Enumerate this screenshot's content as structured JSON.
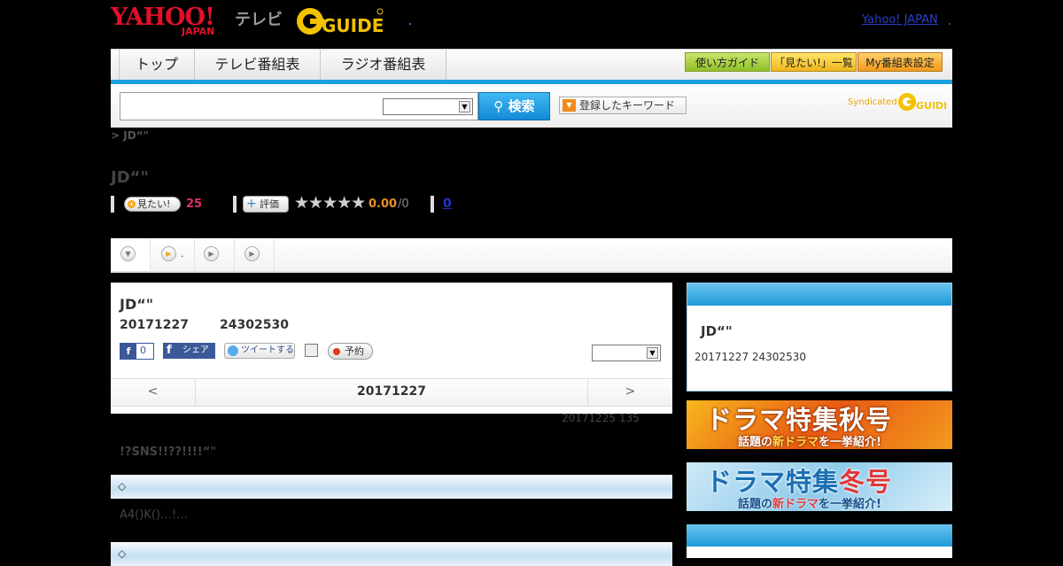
{
  "header": {
    "logo_yahoo": "YAHOO!",
    "logo_japan": "JAPAN",
    "logo_tv": "テレビ",
    "logo_gguide": "GUIDE",
    "yj_link": "Yahoo! JAPAN"
  },
  "nav": {
    "tabs": [
      {
        "label": "トップ"
      },
      {
        "label": "テレビ番組表"
      },
      {
        "label": "ラジオ番組表"
      }
    ],
    "buttons": [
      {
        "label": "使い方ガイド"
      },
      {
        "label": "「見たい!」一覧"
      },
      {
        "label": "My番組表設定"
      }
    ]
  },
  "search": {
    "placeholder": "",
    "button_label": "検索",
    "keyword_button": "登録したキーワード",
    "syndicated": "Syndicated"
  },
  "breadcrumb": "> JD“\"",
  "page_title": "JD“\"",
  "actions": {
    "mitai_label": "見たい!",
    "mitai_count": "25",
    "hyoka_label": "評価",
    "stars": "★★★★★",
    "rating": "0.00",
    "rating_total": "/0",
    "review_count": "0"
  },
  "tabs": [
    {
      "label": ""
    },
    {
      "label": "."
    },
    {
      "label": ""
    },
    {
      "label": ""
    }
  ],
  "program": {
    "title": "JD“\"",
    "date": "20171227",
    "time": "24302530",
    "fb_count": "0",
    "fb_share": "シェア",
    "tweet": "ツイートする",
    "reserve": "予約",
    "pager_prev": "<",
    "pager_date": "20171227",
    "pager_next": ">"
  },
  "meta": "20171225  135",
  "description": "!?SNS!!??!!!!“\"",
  "sections": [
    {
      "label": "◇",
      "body": "A4()K()…!…"
    },
    {
      "label": "◇"
    }
  ],
  "sidebar": {
    "title": "JD“\"",
    "info": "20171227  24302530",
    "banner1": {
      "line1_a": "ドラマ特集",
      "line1_b": "秋号",
      "line2_a": "話題の",
      "line2_b": "新ドラマ",
      "line2_c": "を一挙紹介!"
    },
    "banner2": {
      "line1_a": "ドラマ特集",
      "line1_b": "冬号",
      "line2_a": "話題の",
      "line2_b": "新ドラマ",
      "line2_c": "を一挙紹介!"
    }
  },
  "colors": {
    "accent_blue": "#1aa0de",
    "yahoo_red": "#e0102a",
    "count_pink": "#e0306a",
    "rating_orange": "#e6902a"
  }
}
